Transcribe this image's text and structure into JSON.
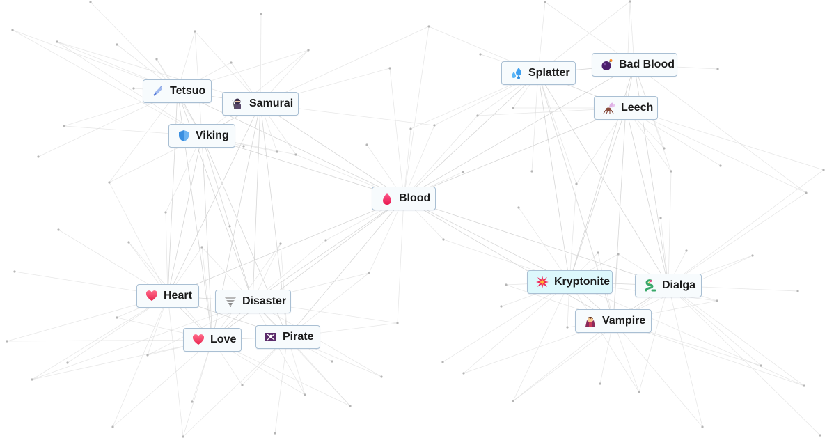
{
  "canvas": {
    "type": "element-combination-graph",
    "background": "#ffffff",
    "edge_color": "#c9c9c9",
    "node_border_color": "#a9bfd3",
    "node_background": "#f7fbfd",
    "highlight_background": "#ddf8fc"
  },
  "nodes": [
    {
      "id": "tetsuo",
      "label": "Tetsuo",
      "icon": "syringe-icon",
      "emoji": "💉"
    },
    {
      "id": "samurai",
      "label": "Samurai",
      "icon": "ninja-icon",
      "emoji": "🥷"
    },
    {
      "id": "viking",
      "label": "Viking",
      "icon": "shield-icon",
      "emoji": "🛡️"
    },
    {
      "id": "blood",
      "label": "Blood",
      "icon": "blood-drop-icon",
      "emoji": "🩸"
    },
    {
      "id": "splatter",
      "label": "Splatter",
      "icon": "sweat-droplets-icon",
      "emoji": "💦"
    },
    {
      "id": "bad-blood",
      "label": "Bad Blood",
      "icon": "bomb-icon",
      "emoji": "💣"
    },
    {
      "id": "leech",
      "label": "Leech",
      "icon": "mosquito-icon",
      "emoji": "🦟"
    },
    {
      "id": "kryptonite",
      "label": "Kryptonite",
      "icon": "collision-icon",
      "emoji": "💥",
      "highlighted": true
    },
    {
      "id": "dialga",
      "label": "Dialga",
      "icon": "dragon-icon",
      "emoji": "🐉"
    },
    {
      "id": "vampire",
      "label": "Vampire",
      "icon": "vampire-icon",
      "emoji": "🧛"
    },
    {
      "id": "heart",
      "label": "Heart",
      "icon": "heart-icon",
      "emoji": "❤️"
    },
    {
      "id": "disaster",
      "label": "Disaster",
      "icon": "tornado-icon",
      "emoji": "🌪️"
    },
    {
      "id": "love",
      "label": "Love",
      "icon": "heart-icon",
      "emoji": "❤️"
    },
    {
      "id": "pirate",
      "label": "Pirate",
      "icon": "pirate-flag-icon",
      "emoji": "☠"
    }
  ]
}
